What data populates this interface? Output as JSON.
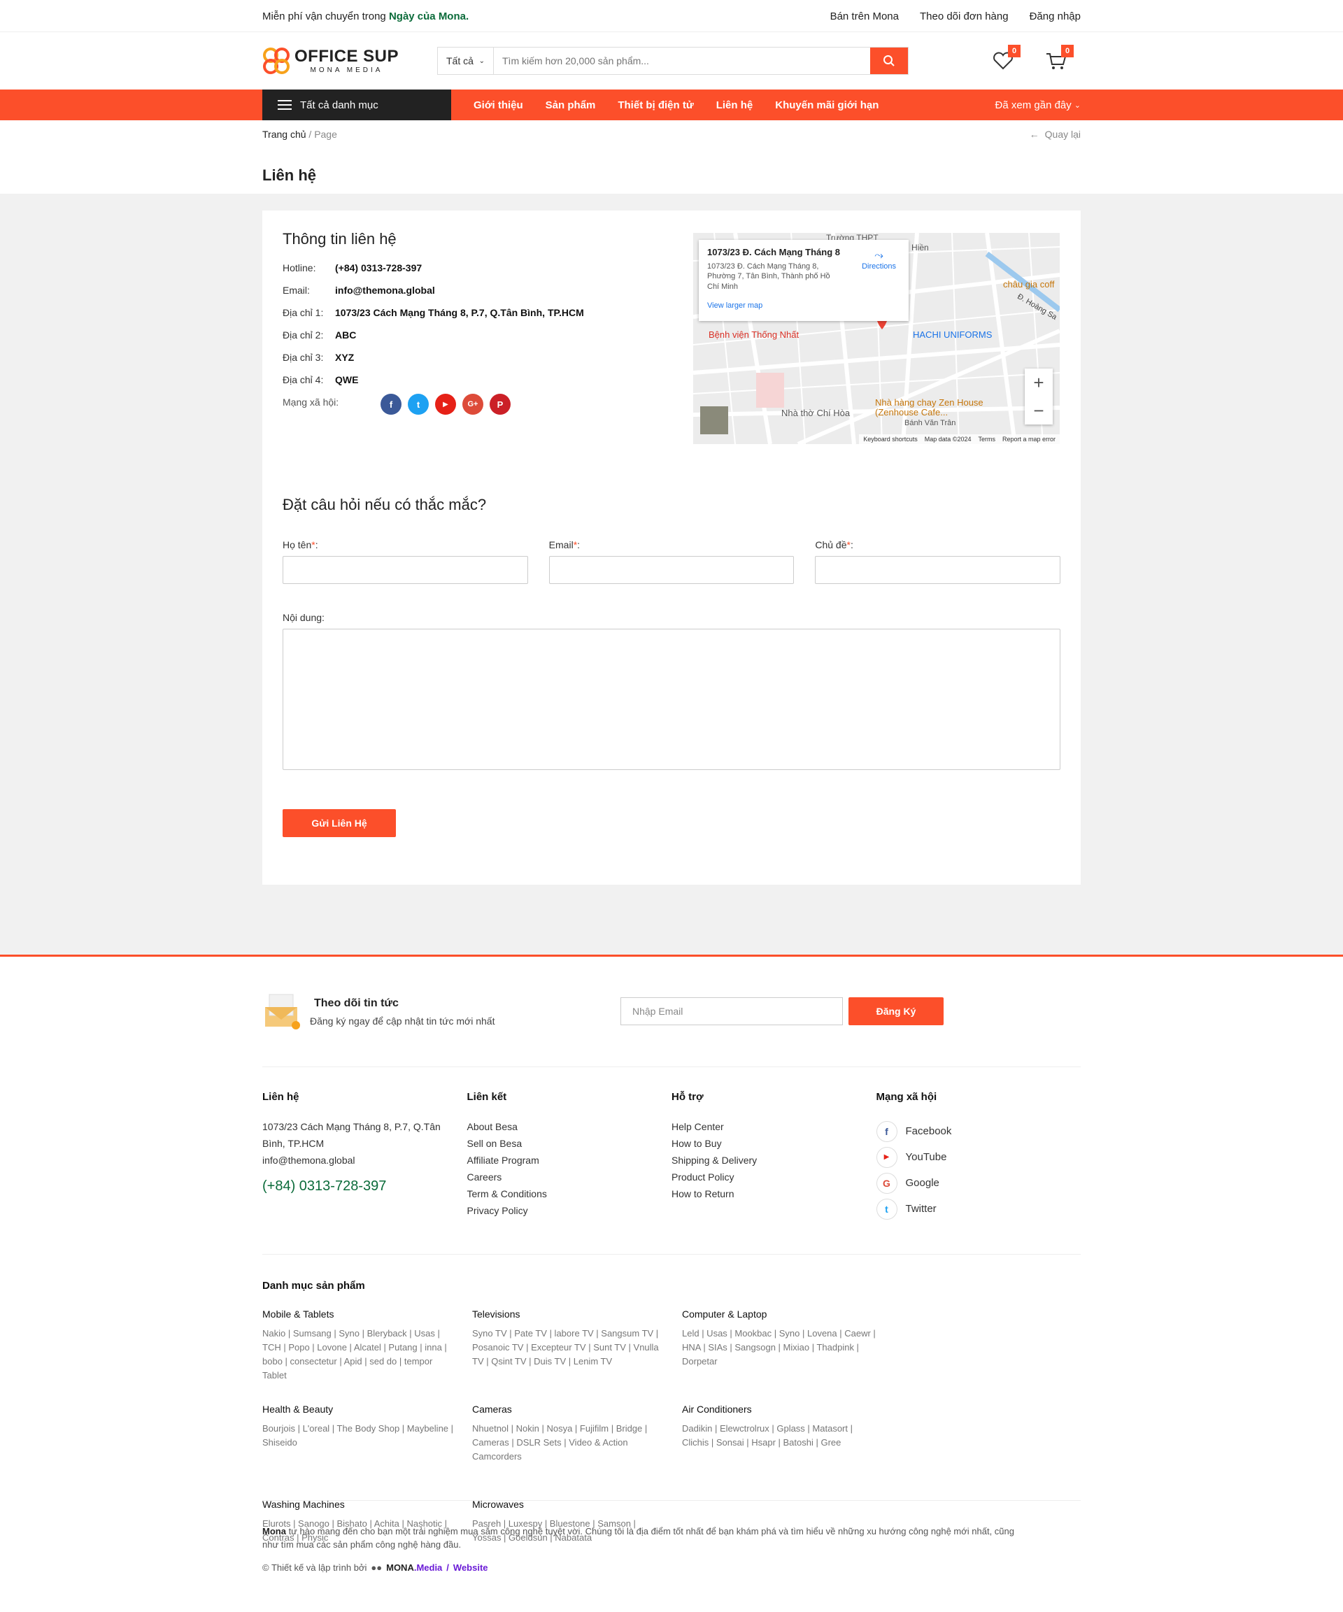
{
  "topbar": {
    "promo_prefix": "Miễn phí vận chuyển trong ",
    "promo_bold": "Ngày của Mona.",
    "links": [
      "Bán trên Mona",
      "Theo dõi đơn hàng",
      "Đăng nhập"
    ]
  },
  "header": {
    "logo_title": "OFFICE SUP",
    "logo_sub": "MONA MEDIA",
    "search_category": "Tất cả",
    "search_placeholder": "Tìm kiếm hơn 20,000 sản phẩm...",
    "wishlist_count": "0",
    "cart_count": "0"
  },
  "nav": {
    "all_categories": "Tất cả danh mục",
    "items": [
      "Giới thiệu",
      "Sản phẩm",
      "Thiết bị điện tử",
      "Liên hệ",
      "Khuyến mãi giới hạn"
    ],
    "recent": "Đã xem gần đây"
  },
  "breadcrumb": {
    "home": "Trang chủ",
    "sep": " / ",
    "current": "Page",
    "back": "Quay lại"
  },
  "page_title": "Liên hệ",
  "contact": {
    "title": "Thông tin liên hệ",
    "rows": [
      {
        "k": "Hotline:",
        "v": "(+84) 0313-728-397"
      },
      {
        "k": "Email:",
        "v": "info@themona.global"
      },
      {
        "k": "Địa chỉ 1:",
        "v": "1073/23 Cách Mạng Tháng 8, P.7, Q.Tân Bình, TP.HCM"
      },
      {
        "k": "Địa chỉ 2:",
        "v": "ABC"
      },
      {
        "k": "Địa chỉ 3:",
        "v": "XYZ"
      },
      {
        "k": "Địa chỉ 4:",
        "v": "QWE"
      }
    ],
    "social_label": "Mạng xã hội:",
    "socials": [
      {
        "icon": "facebook-icon",
        "glyph": "f",
        "color": "#3b5998"
      },
      {
        "icon": "twitter-icon",
        "glyph": "t",
        "color": "#1da1f2"
      },
      {
        "icon": "youtube-icon",
        "glyph": "▶",
        "color": "#e62117"
      },
      {
        "icon": "google-plus-icon",
        "glyph": "G+",
        "color": "#dd4b39"
      },
      {
        "icon": "pinterest-icon",
        "glyph": "P",
        "color": "#cb2027"
      }
    ]
  },
  "map": {
    "popup_title": "1073/23 Đ. Cách Mạng Tháng 8",
    "popup_address": "1073/23 Đ. Cách Mạng Tháng 8, Phường 7, Tân Bình, Thành phố Hồ Chí Minh",
    "directions": "Directions",
    "larger_map": "View larger map",
    "labels": [
      "Bệnh viện Thống Nhất",
      "HACHI UNIFORMS",
      "Nhà thờ Chí Hòa",
      "Nhà hàng chay Zen House (Zenhouse Cafe...",
      "Bánh Văn Trân",
      "châu gia coff",
      "Đ. Hoàng Sa",
      "Trường THPT",
      "Hiền"
    ],
    "footer": [
      "Keyboard shortcuts",
      "Map data ©2024",
      "Terms",
      "Report a map error"
    ],
    "zoom_in": "+",
    "zoom_out": "−"
  },
  "form": {
    "title": "Đặt câu hỏi nếu có thắc mắc?",
    "name_label": "Họ tên",
    "email_label": "Email",
    "subject_label": "Chủ đề",
    "required": "*",
    "colon": ":",
    "content_label": "Nội dung:",
    "submit": "Gửi Liên Hệ"
  },
  "newsletter": {
    "title": "Theo dõi tin tức",
    "subtitle": "Đăng ký ngay để cập nhật tin tức mới nhất",
    "placeholder": "Nhập Email",
    "button": "Đăng Ký"
  },
  "footer": {
    "contact": {
      "title": "Liên hệ",
      "address": "1073/23 Cách Mạng Tháng 8, P.7, Q.Tân Bình, TP.HCM",
      "email": "info@themona.global",
      "phone": "(+84) 0313-728-397"
    },
    "links": {
      "title": "Liên kết",
      "items": [
        "About Besa",
        "Sell on Besa",
        "Affiliate Program",
        "Careers",
        "Term & Conditions",
        "Privacy Policy"
      ]
    },
    "support": {
      "title": "Hỗ trợ",
      "items": [
        "Help Center",
        "How to Buy",
        "Shipping & Delivery",
        "Product Policy",
        "How to Return"
      ]
    },
    "social": {
      "title": "Mạng xã hội",
      "items": [
        {
          "name": "Facebook",
          "icon": "facebook-icon",
          "glyph": "f",
          "color": "#3b5998"
        },
        {
          "name": "YouTube",
          "icon": "youtube-icon",
          "glyph": "▶",
          "color": "#e62117"
        },
        {
          "name": "Google",
          "icon": "google-icon",
          "glyph": "G",
          "color": "#dd4b39"
        },
        {
          "name": "Twitter",
          "icon": "twitter-icon",
          "glyph": "t",
          "color": "#1da1f2"
        }
      ]
    }
  },
  "categories": {
    "title": "Danh mục sản phẩm",
    "groups": [
      {
        "name": "Mobile & Tablets",
        "items": "Nakio | Sumsang | Syno | Bleryback | Usas | TCH | Popo | Lovone | Alcatel | Putang | inna | bobo | consectetur | Apid | sed do | tempor Tablet"
      },
      {
        "name": "Televisions",
        "items": "Syno TV | Pate TV | labore TV | Sangsum TV | Posanoic TV | Excepteur TV | Sunt TV | Vnulla TV | Qsint TV | Duis TV | Lenim TV"
      },
      {
        "name": "Computer & Laptop",
        "items": "Leld | Usas | Mookbac | Syno | Lovena | Caewr | HNA | SIAs | Sangsogn | Mixiao | Thadpink | Dorpetar"
      },
      {
        "name": "Health & Beauty",
        "items": "Bourjois | L'oreal | The Body Shop | Maybeline | Shiseido"
      },
      {
        "name": "Cameras",
        "items": "Nhuetnol | Nokin | Nosya | Fujifilm | Bridge | Cameras | DSLR Sets | Video & Action Camcorders"
      },
      {
        "name": "Air Conditioners",
        "items": "Dadikin | Elewctrolrux | Gplass | Matasort | Clichis | Sonsai | Hsapr | Batoshi | Gree"
      },
      {
        "name": "Washing Machines",
        "items": "Elurots | Sanogo | Bishato | Achita | Nashotic | Contras | Physic"
      },
      {
        "name": "Microwaves",
        "items": "Pasreh | Luxespy | Bluestone | Samson | Yossas | Goeldsun | Nabatata"
      }
    ]
  },
  "about": {
    "brand": "Mona",
    "text": " tự hào mang đến cho bạn một trải nghiệm mua sắm công nghệ tuyệt vời. Chúng tôi là địa điểm tốt nhất để bạn khám phá và tìm hiểu về những xu hướng công nghệ mới nhất, cũng như tìm mua các sản phẩm công nghệ hàng đầu."
  },
  "credit": {
    "prefix": "© Thiết kế và lập trình bởi",
    "brand": "MONA",
    "media": ".Media",
    "slash": " / ",
    "website": "Website"
  },
  "colors": {
    "accent": "#fc4f2a",
    "green": "#0b6b3a",
    "dark": "#222222"
  }
}
